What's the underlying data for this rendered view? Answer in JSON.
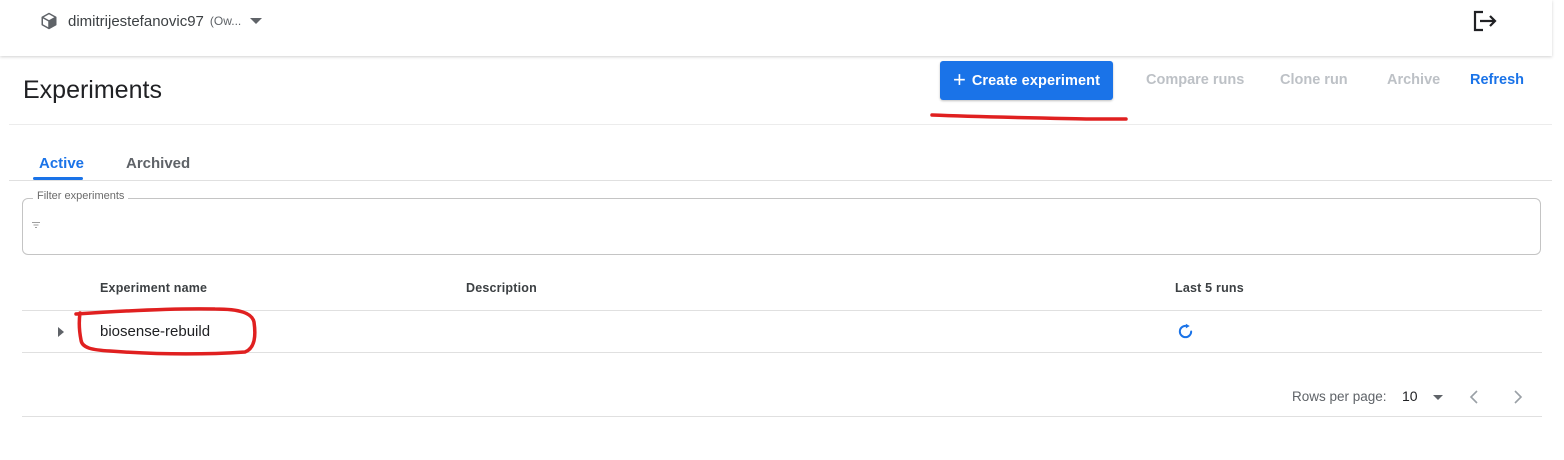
{
  "namespace": {
    "name": "dimitrijestefanovic97",
    "role": "(Ow..."
  },
  "page_title": "Experiments",
  "toolbar": {
    "create_plus": "+",
    "create_label": "Create experiment",
    "compare_label": "Compare runs",
    "clone_label": "Clone run",
    "archive_label": "Archive",
    "refresh_label": "Refresh"
  },
  "tabs": [
    {
      "label": "Active",
      "selected": true
    },
    {
      "label": "Archived",
      "selected": false
    }
  ],
  "filter": {
    "label": "Filter experiments",
    "value": ""
  },
  "table": {
    "columns": [
      "Experiment name",
      "Description",
      "Last 5 runs"
    ],
    "rows": [
      {
        "name": "biosense-rebuild",
        "description": "",
        "last_runs_icon": "refresh-icon"
      }
    ]
  },
  "pagination": {
    "rows_per_page_label": "Rows per page:",
    "rows_per_page": "10"
  },
  "colors": {
    "accent": "#1a73e8",
    "disabled": "#bdc1c6",
    "annotation": "#e02020"
  },
  "icons": [
    "cube-icon",
    "logout-icon",
    "filter-icon",
    "expand-arrow-icon",
    "refresh-icon",
    "chevron-left-icon",
    "chevron-right-icon"
  ]
}
